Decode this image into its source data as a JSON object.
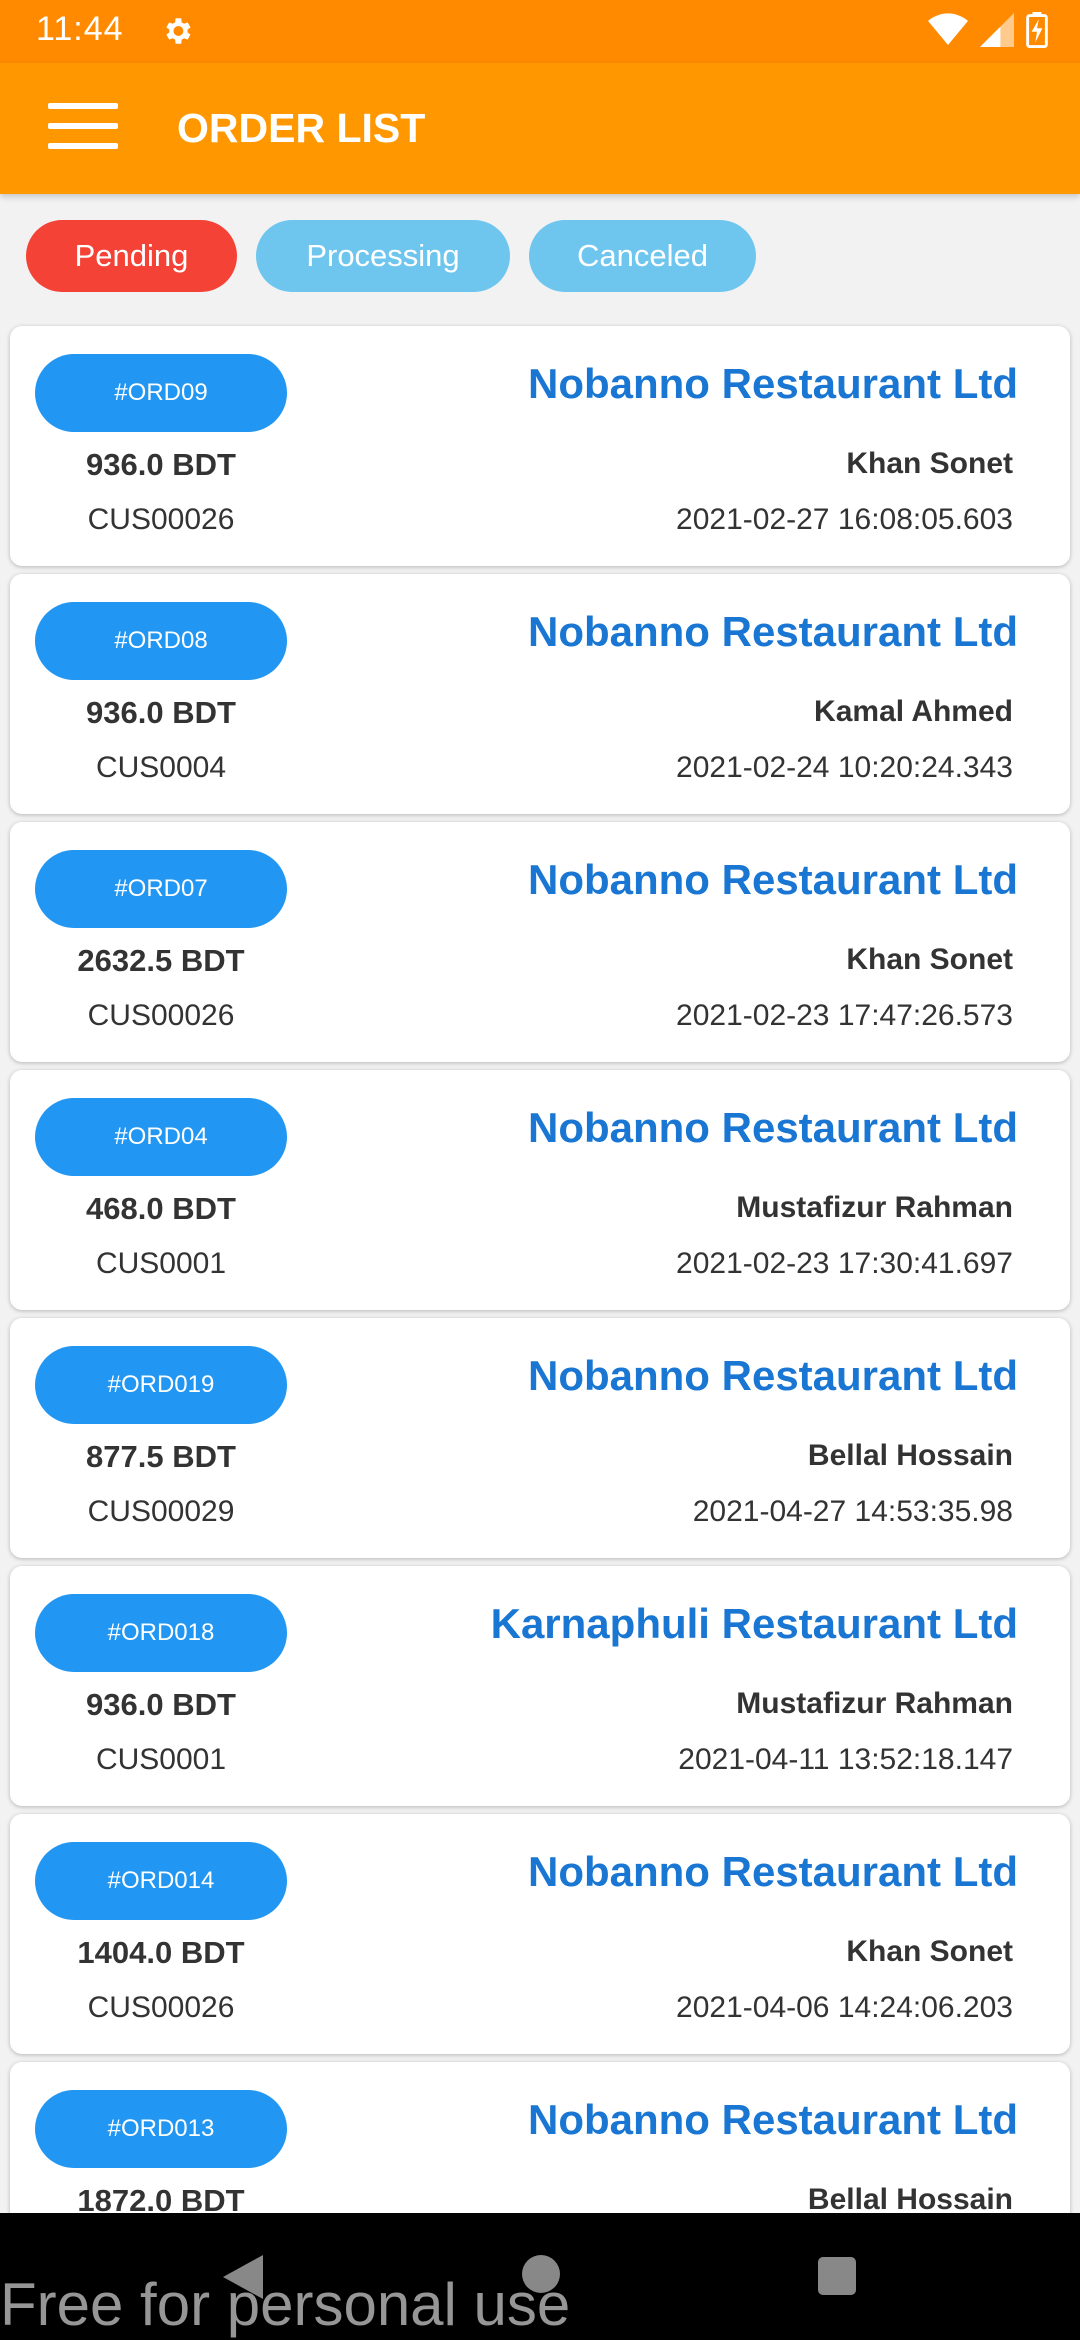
{
  "status_bar": {
    "time": "11:44"
  },
  "app_bar": {
    "title": "ORDER LIST"
  },
  "filters": {
    "pending": "Pending",
    "processing": "Processing",
    "canceled": "Canceled"
  },
  "colors": {
    "app_bar": "#ff9800",
    "status_bar": "#ff8a00",
    "pending_chip": "#f44336",
    "inactive_chip": "#6ec6ef",
    "order_badge": "#2196f3",
    "restaurant_text": "#1976d2"
  },
  "orders": [
    {
      "id": "#ORD09",
      "amount": "936.0 BDT",
      "customer_id": "CUS00026",
      "restaurant": "Nobanno Restaurant Ltd",
      "customer_name": "Khan Sonet",
      "datetime": "2021-02-27 16:08:05.603"
    },
    {
      "id": "#ORD08",
      "amount": "936.0 BDT",
      "customer_id": "CUS0004",
      "restaurant": "Nobanno Restaurant Ltd",
      "customer_name": "Kamal Ahmed",
      "datetime": "2021-02-24 10:20:24.343"
    },
    {
      "id": "#ORD07",
      "amount": "2632.5 BDT",
      "customer_id": "CUS00026",
      "restaurant": "Nobanno Restaurant Ltd",
      "customer_name": "Khan Sonet",
      "datetime": "2021-02-23 17:47:26.573"
    },
    {
      "id": "#ORD04",
      "amount": "468.0 BDT",
      "customer_id": "CUS0001",
      "restaurant": "Nobanno Restaurant Ltd",
      "customer_name": "Mustafizur Rahman",
      "datetime": "2021-02-23 17:30:41.697"
    },
    {
      "id": "#ORD019",
      "amount": "877.5 BDT",
      "customer_id": "CUS00029",
      "restaurant": "Nobanno Restaurant Ltd",
      "customer_name": "Bellal Hossain",
      "datetime": "2021-04-27 14:53:35.98"
    },
    {
      "id": "#ORD018",
      "amount": "936.0 BDT",
      "customer_id": "CUS0001",
      "restaurant": "Karnaphuli Restaurant Ltd",
      "customer_name": "Mustafizur Rahman",
      "datetime": "2021-04-11 13:52:18.147"
    },
    {
      "id": "#ORD014",
      "amount": "1404.0 BDT",
      "customer_id": "CUS00026",
      "restaurant": "Nobanno Restaurant Ltd",
      "customer_name": "Khan Sonet",
      "datetime": "2021-04-06 14:24:06.203"
    },
    {
      "id": "#ORD013",
      "amount": "1872.0 BDT",
      "customer_id": "",
      "restaurant": "Nobanno Restaurant Ltd",
      "customer_name": "Bellal Hossain",
      "datetime": ""
    }
  ],
  "watermark": "Free for personal use"
}
